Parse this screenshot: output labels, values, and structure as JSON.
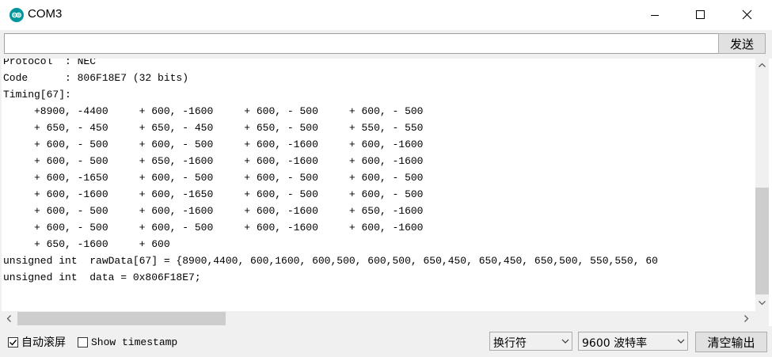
{
  "window": {
    "title": "COM3"
  },
  "send": {
    "input_value": "",
    "button_label": "发送"
  },
  "output_lines": [
    "Protocol  : NEC",
    "Code      : 806F18E7 (32 bits)",
    "Timing[67]:",
    "     +8900, -4400     + 600, -1600     + 600, - 500     + 600, - 500",
    "     + 650, - 450     + 650, - 450     + 650, - 500     + 550, - 550",
    "     + 600, - 500     + 600, - 500     + 600, -1600     + 600, -1600",
    "     + 600, - 500     + 650, -1600     + 600, -1600     + 600, -1600",
    "     + 600, -1650     + 600, - 500     + 600, - 500     + 600, - 500",
    "     + 600, -1600     + 600, -1650     + 600, - 500     + 600, - 500",
    "     + 600, - 500     + 600, -1600     + 600, -1600     + 650, -1600",
    "     + 600, - 500     + 600, - 500     + 600, -1600     + 600, -1600",
    "     + 650, -1600     + 600",
    "unsigned int  rawData[67] = {8900,4400, 600,1600, 600,500, 600,500, 650,450, 650,450, 650,500, 550,550, 60",
    "unsigned int  data = 0x806F18E7;",
    "",
    ""
  ],
  "bottom": {
    "autoscroll_label": "自动滚屏",
    "autoscroll_checked": true,
    "timestamp_label": "Show timestamp",
    "timestamp_checked": false,
    "line_ending": "换行符",
    "baud_rate": "9600 波特率",
    "clear_label": "清空输出"
  },
  "colors": {
    "app_icon": "#00979c",
    "thumb": "#cdcdcd",
    "chrome": "#f0f0f0"
  }
}
